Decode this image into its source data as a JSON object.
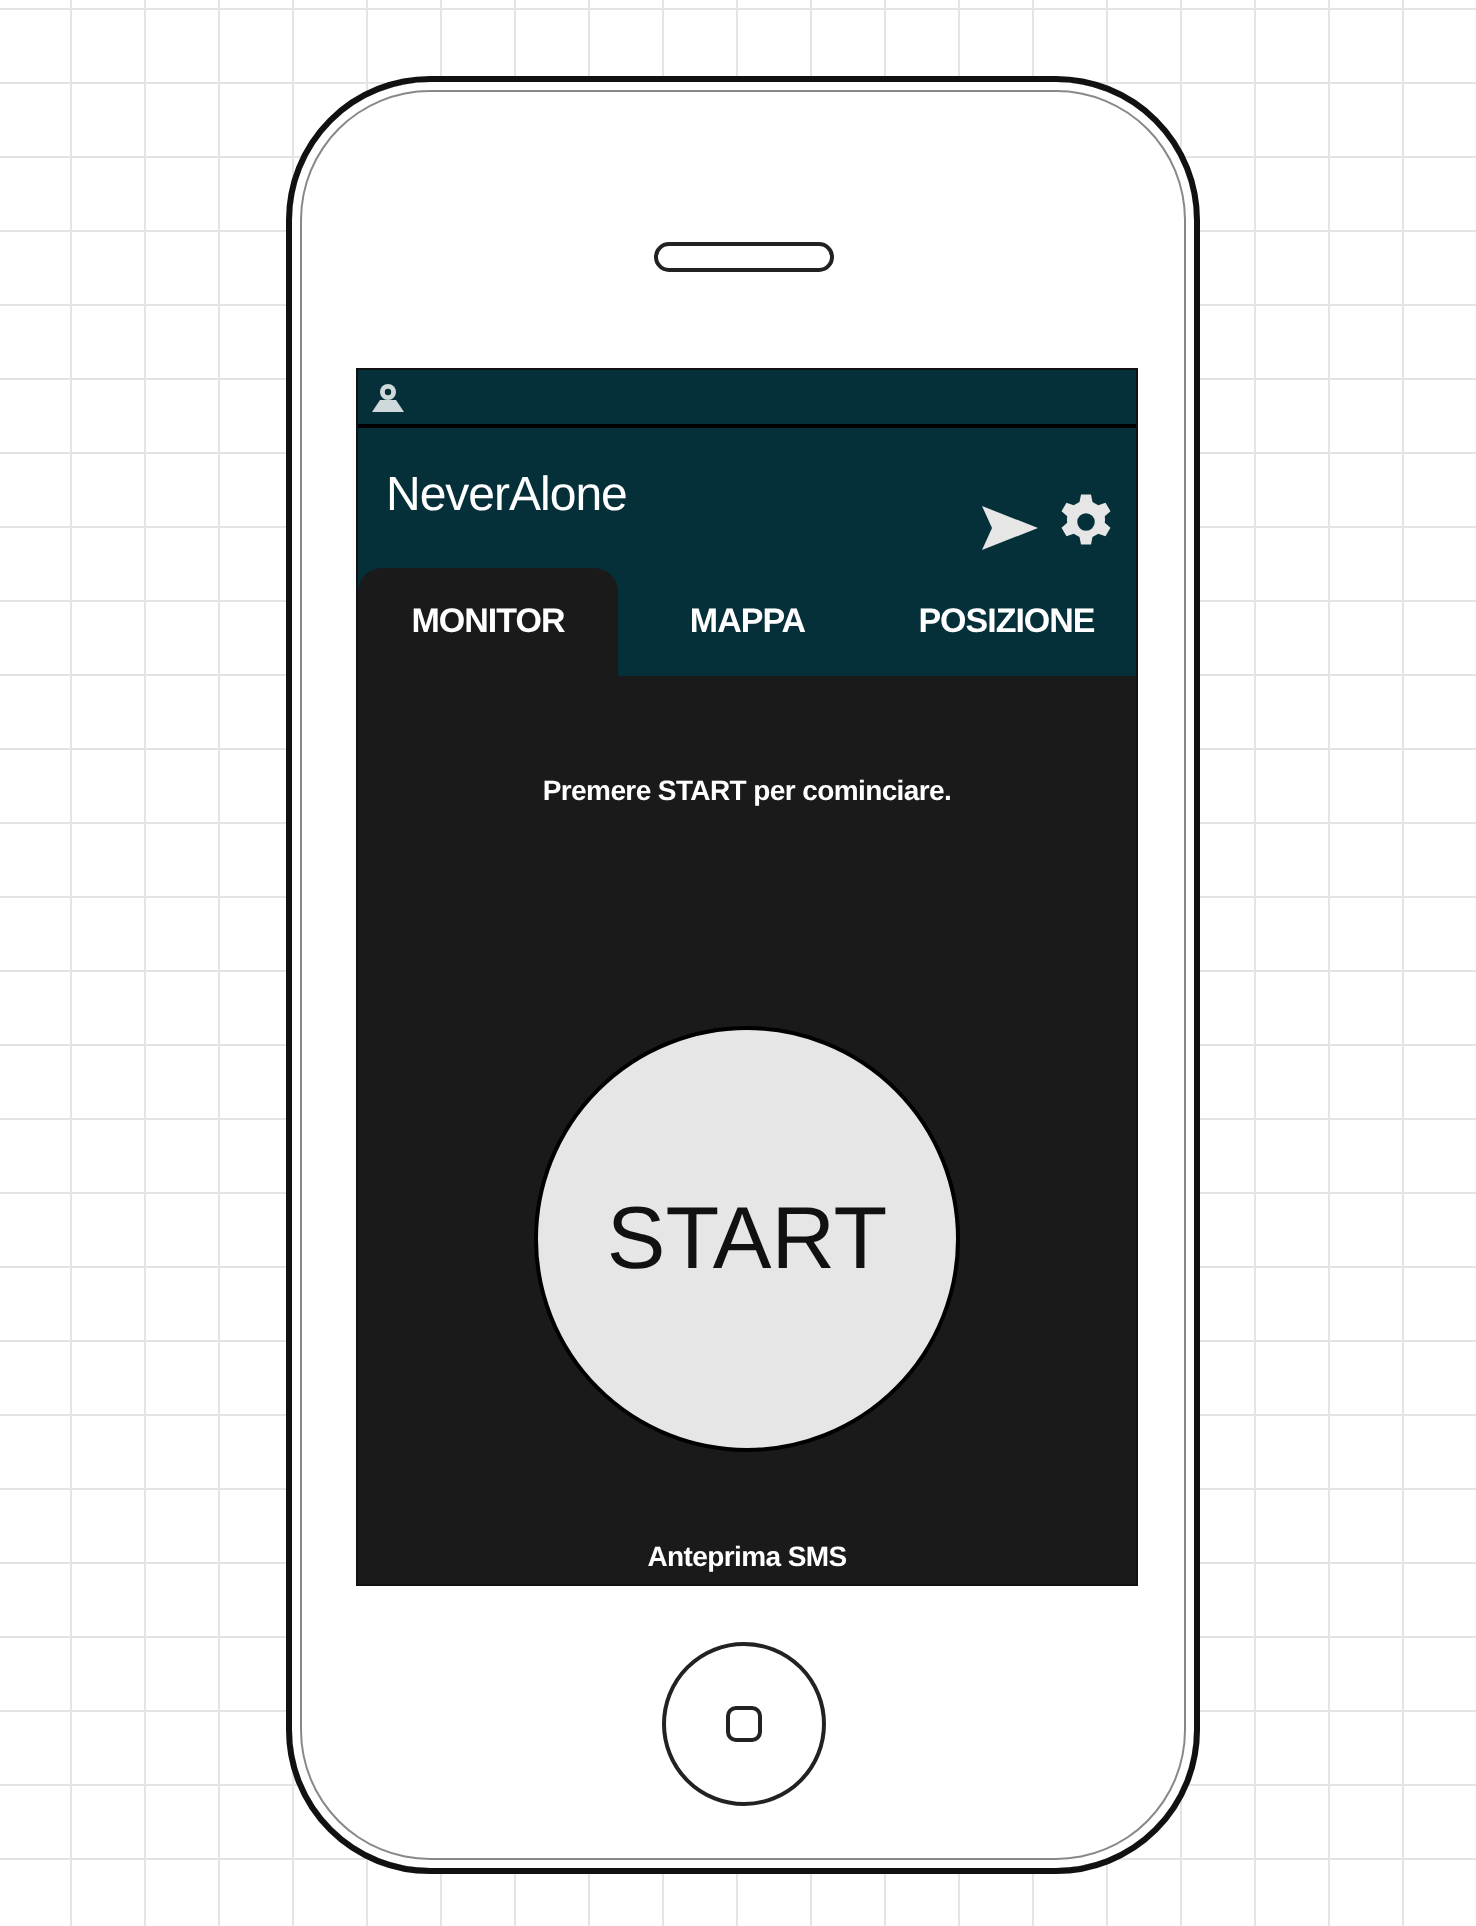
{
  "app_bar": {
    "title": "NeverAlone"
  },
  "tabs": [
    {
      "label": "MONITOR",
      "selected": true
    },
    {
      "label": "MAPPA",
      "selected": false
    },
    {
      "label": "POSIZIONE",
      "selected": false
    }
  ],
  "monitor": {
    "instruction": "Premere START per cominciare.",
    "start_button": "START",
    "preview_link": "Anteprima SMS"
  }
}
